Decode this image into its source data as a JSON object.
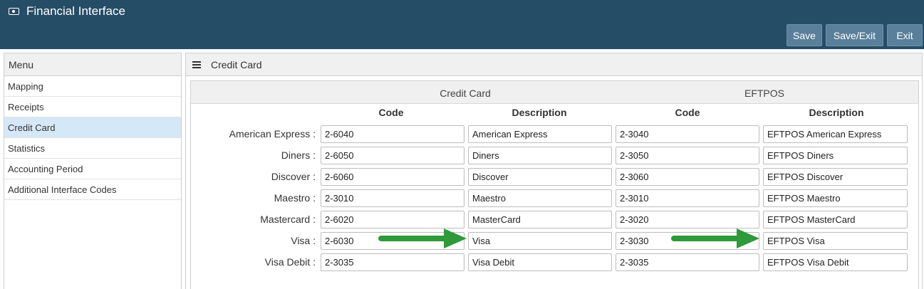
{
  "header": {
    "title": "Financial Interface",
    "title_icon": "money-icon",
    "buttons": [
      "Save",
      "Save/Exit",
      "Exit"
    ]
  },
  "sidebar": {
    "title": "Menu",
    "items": [
      {
        "label": "Mapping",
        "active": false
      },
      {
        "label": "Receipts",
        "active": false
      },
      {
        "label": "Credit Card",
        "active": true
      },
      {
        "label": "Statistics",
        "active": false
      },
      {
        "label": "Accounting Period",
        "active": false
      },
      {
        "label": "Additional Interface Codes",
        "active": false
      }
    ]
  },
  "main": {
    "title": "Credit Card",
    "title_icon": "hamburger-icon",
    "groups": [
      "Credit Card",
      "EFTPOS"
    ],
    "columns": [
      "Code",
      "Description",
      "Code",
      "Description"
    ],
    "rows": [
      {
        "label": "American Express :",
        "cc_code": "2-6040",
        "cc_desc": "American Express",
        "ef_code": "2-3040",
        "ef_desc": "EFTPOS American Express"
      },
      {
        "label": "Diners :",
        "cc_code": "2-6050",
        "cc_desc": "Diners",
        "ef_code": "2-3050",
        "ef_desc": "EFTPOS Diners"
      },
      {
        "label": "Discover :",
        "cc_code": "2-6060",
        "cc_desc": "Discover",
        "ef_code": "2-3060",
        "ef_desc": "EFTPOS Discover"
      },
      {
        "label": "Maestro :",
        "cc_code": "2-3010",
        "cc_desc": "Maestro",
        "ef_code": "2-3010",
        "ef_desc": "EFTPOS Maestro"
      },
      {
        "label": "Mastercard :",
        "cc_code": "2-6020",
        "cc_desc": "MasterCard",
        "ef_code": "2-3020",
        "ef_desc": "EFTPOS MasterCard"
      },
      {
        "label": "Visa :",
        "cc_code": "2-6030",
        "cc_desc": "Visa",
        "ef_code": "2-3030",
        "ef_desc": "EFTPOS Visa"
      },
      {
        "label": "Visa Debit :",
        "cc_code": "2-3035",
        "cc_desc": "Visa Debit",
        "ef_code": "2-3035",
        "ef_desc": "EFTPOS Visa Debit"
      }
    ]
  },
  "colors": {
    "header_bg": "#264d66",
    "button_bg": "#5a7f9a",
    "active_menu_bg": "#d5e8f7",
    "arrow_green": "#2e9a3a"
  }
}
